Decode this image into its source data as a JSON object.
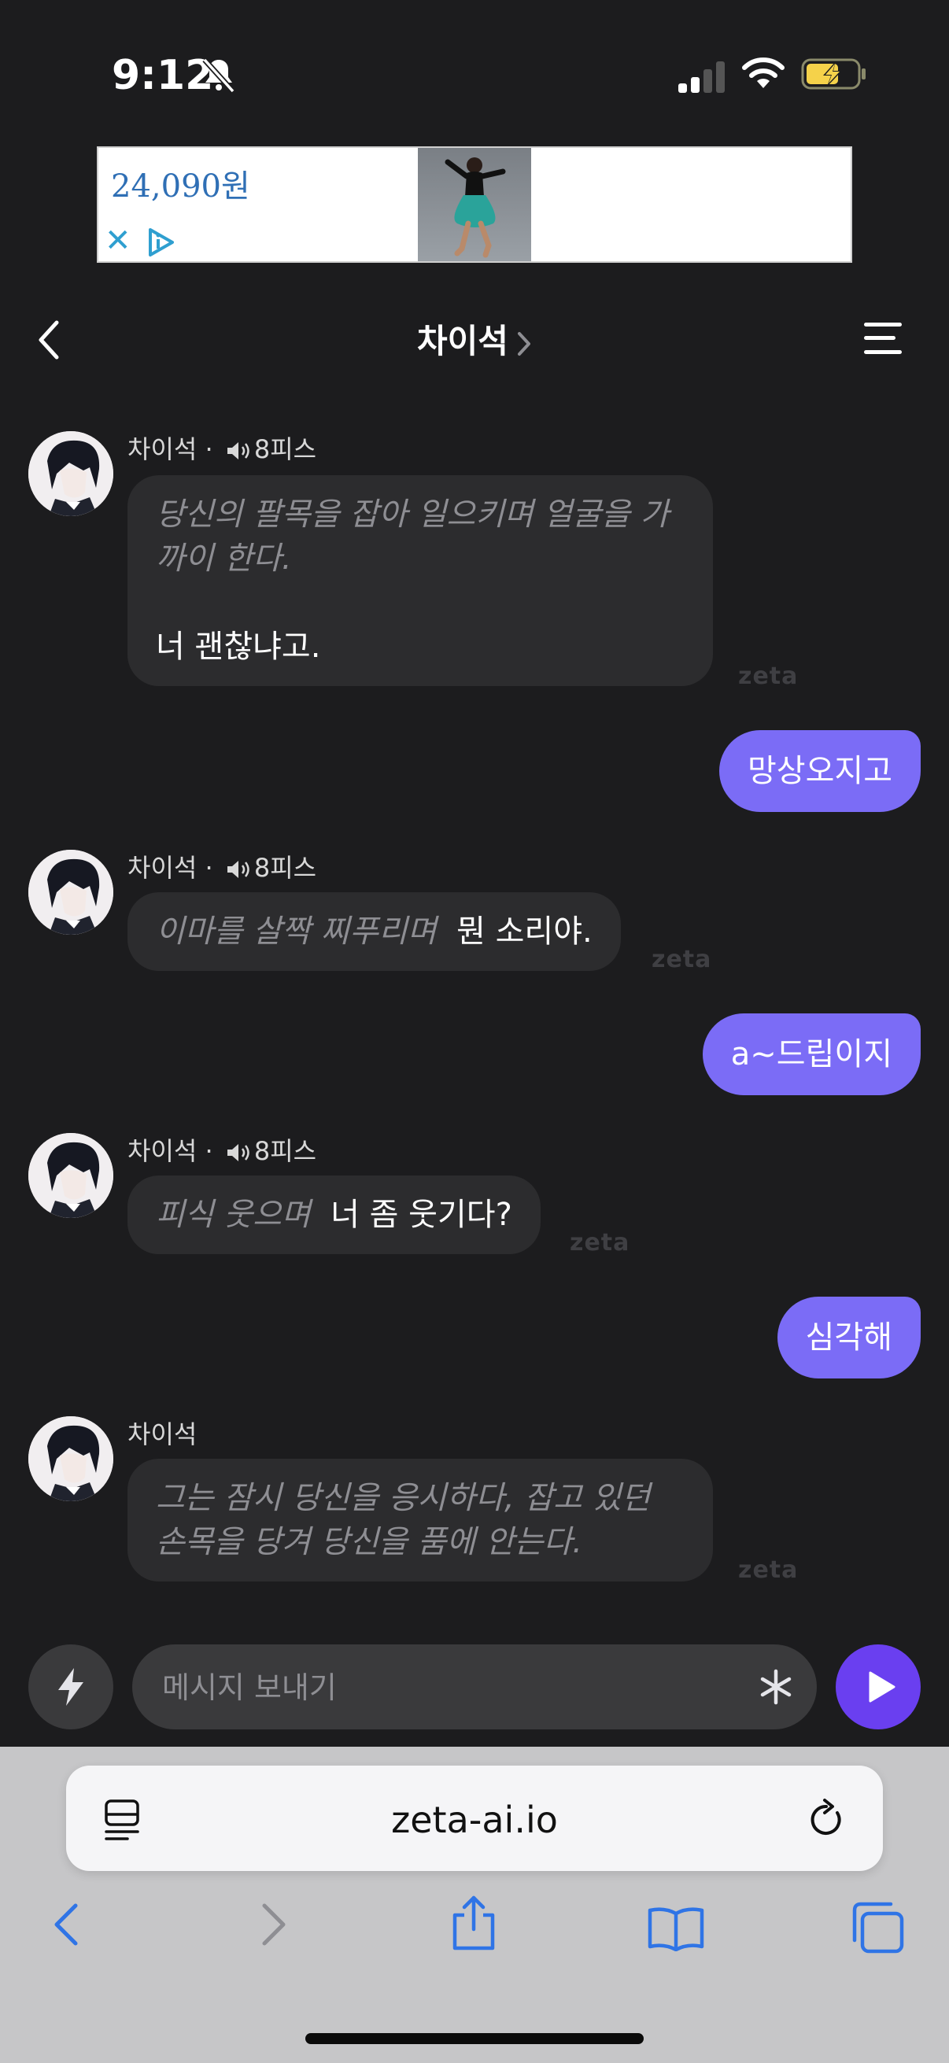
{
  "status_bar": {
    "time": "9:12"
  },
  "ad": {
    "price": "24,090원",
    "close_glyph": "✕"
  },
  "header": {
    "title": "차이석"
  },
  "messages": [
    {
      "role": "ai",
      "name": "차이석",
      "meta": "8피스",
      "action": "당신의 팔목을 잡아 일으키며 얼굴을 가까이 한다.",
      "speech": "너 괜찮냐고.",
      "watermark": "zeta"
    },
    {
      "role": "user",
      "text": "망상오지고"
    },
    {
      "role": "ai",
      "name": "차이석",
      "meta": "8피스",
      "action": "이마를 살짝 찌푸리며",
      "speech": "뭔 소리야.",
      "watermark": "zeta"
    },
    {
      "role": "user",
      "text": "a~드립이지"
    },
    {
      "role": "ai",
      "name": "차이석",
      "meta": "8피스",
      "action": "피식 웃으며",
      "speech": "너 좀 웃기다?",
      "watermark": "zeta"
    },
    {
      "role": "user",
      "text": "심각해"
    },
    {
      "role": "ai",
      "name": "차이석",
      "action": "그는 잠시 당신을 응시하다, 잡고 있던 손목을 당겨 당신을 품에 안는다.",
      "watermark": "zeta"
    }
  ],
  "composer": {
    "placeholder": "메시지 보내기"
  },
  "browser": {
    "url": "zeta-ai.io"
  },
  "icons": {
    "back": "chevron-left-icon",
    "menu": "hamburger-menu-icon",
    "bolt": "lightning-icon",
    "send": "play-send-icon",
    "asterisk": "asterisk-icon",
    "speaker": "speaker-icon"
  },
  "colors": {
    "background": "#1c1c1e",
    "ai_bubble": "#2c2c2e",
    "user_bubble": "#7b6cf6",
    "send_button": "#6a3ff0",
    "safari_blue": "#2f74e6"
  }
}
